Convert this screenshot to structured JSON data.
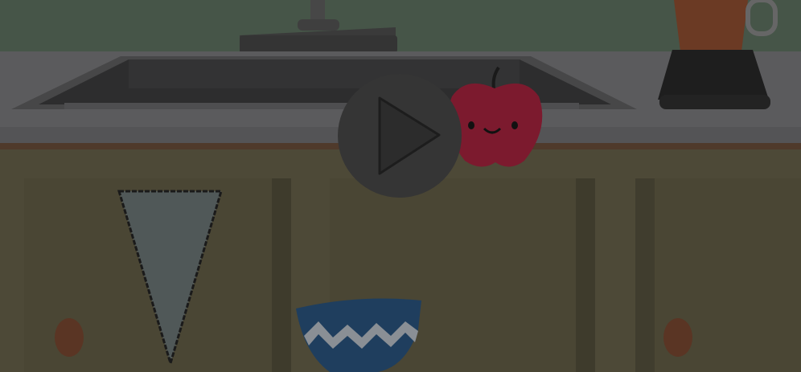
{
  "scene": {
    "name": "kitchen-counter",
    "items": [
      "faucet-icon",
      "sink-icon",
      "blender-icon",
      "apple-character-icon",
      "ice-cream-cone-icon",
      "bowl-icon",
      "cabinet-knob-icon"
    ]
  },
  "overlay": {
    "play_icon": "play-icon",
    "dimmed": true
  },
  "colors": {
    "wall": "#465548",
    "counter": "#5b5b5d",
    "cabinet": "#4d4937",
    "apple": "#7c1a2e",
    "bowl": "#1f3e5e",
    "cone": "#505858",
    "play_bg": "#353535"
  }
}
